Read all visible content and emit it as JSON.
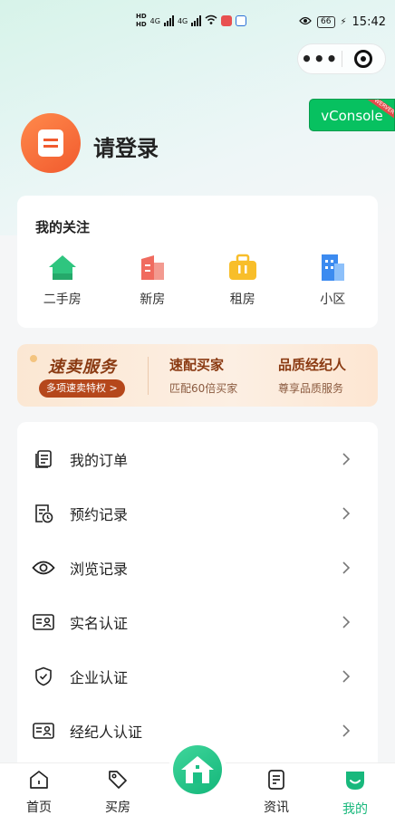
{
  "status_bar": {
    "network1": "4G",
    "network2": "4G",
    "battery": "66",
    "time": "15:42"
  },
  "capsule": {
    "more_icon": "more-dots-icon",
    "close_icon": "target-icon"
  },
  "vconsole": {
    "label": "vConsole",
    "ribbon": "WERVER"
  },
  "login": {
    "text": "请登录"
  },
  "follow": {
    "title": "我的关注",
    "items": [
      {
        "label": "二手房",
        "icon": "house-icon",
        "color": "#2fc57f"
      },
      {
        "label": "新房",
        "icon": "building-icon",
        "color": "#f06b5f"
      },
      {
        "label": "租房",
        "icon": "briefcase-icon",
        "color": "#f8be2a"
      },
      {
        "label": "小区",
        "icon": "community-icon",
        "color": "#3c8bf0"
      }
    ]
  },
  "banner": {
    "title": "速卖服务",
    "pill": "多项速卖特权 >",
    "col2_title": "速配买家",
    "col2_sub": "匹配60倍买家",
    "col3_title": "品质经纪人",
    "col3_sub": "尊享品质服务"
  },
  "menu": [
    {
      "label": "我的订单",
      "icon": "orders-icon"
    },
    {
      "label": "预约记录",
      "icon": "appointment-icon"
    },
    {
      "label": "浏览记录",
      "icon": "eye-icon"
    },
    {
      "label": "实名认证",
      "icon": "id-card-icon"
    },
    {
      "label": "企业认证",
      "icon": "shield-icon"
    },
    {
      "label": "经纪人认证",
      "icon": "agent-card-icon"
    }
  ],
  "tabbar": {
    "tabs": [
      {
        "label": "首页",
        "icon": "home-icon"
      },
      {
        "label": "买房",
        "icon": "tag-icon"
      },
      {
        "label": "资讯",
        "icon": "news-icon"
      },
      {
        "label": "我的",
        "icon": "profile-icon",
        "active": true
      }
    ],
    "center_icon": "center-house-icon",
    "accent": "#18b87c"
  }
}
